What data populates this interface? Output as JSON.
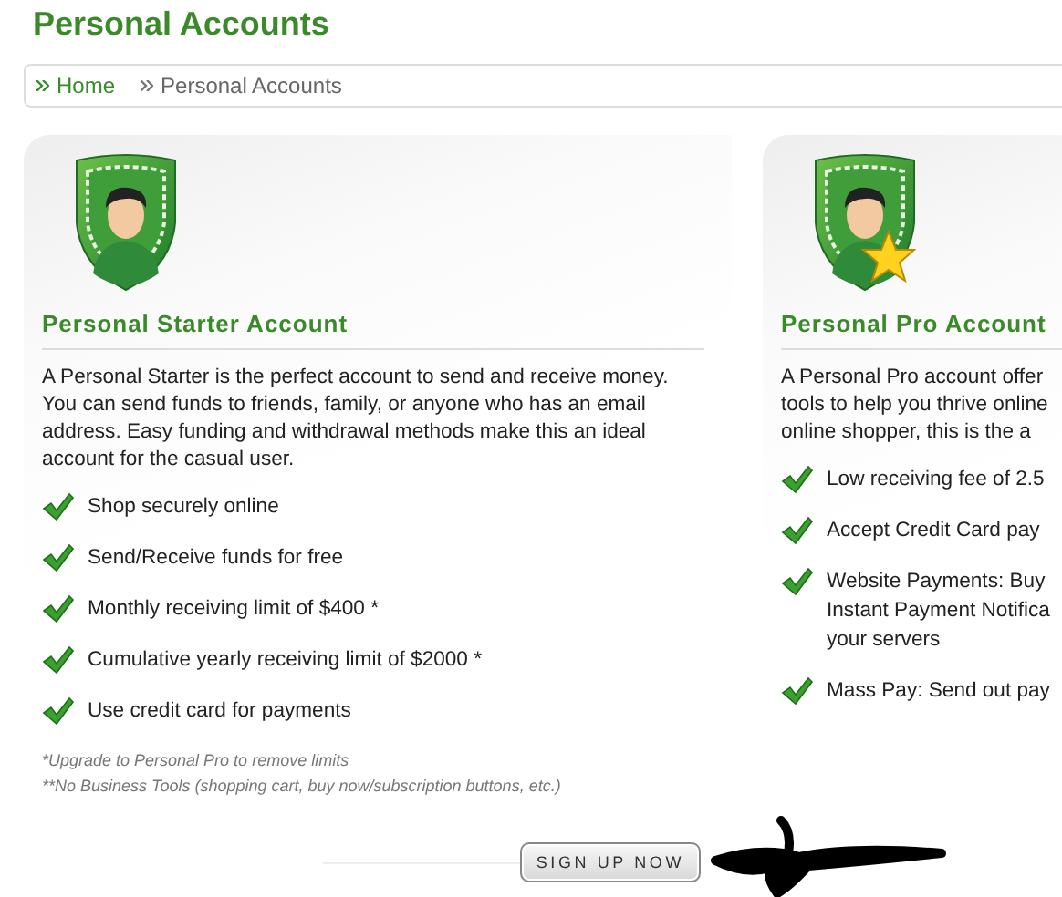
{
  "page_title": "Personal Accounts",
  "breadcrumb": [
    {
      "label": "Home",
      "link": true
    },
    {
      "label": "Personal Accounts",
      "link": false
    }
  ],
  "cards": [
    {
      "title": "Personal Starter Account",
      "star": false,
      "description_lines": [
        "A Personal Starter is the perfect account to send and receive money. You can send funds to friends, family, or anyone who has an email address. Easy funding and withdrawal methods make this an ideal account for the casual user."
      ],
      "features": [
        {
          "lines": [
            "Shop securely online"
          ]
        },
        {
          "lines": [
            "Send/Receive funds for free"
          ]
        },
        {
          "lines": [
            "Monthly receiving limit of $400 *"
          ]
        },
        {
          "lines": [
            "Cumulative yearly receiving limit of $2000 *"
          ]
        },
        {
          "lines": [
            "Use credit card for payments"
          ]
        }
      ],
      "footnotes": [
        "*Upgrade to Personal Pro to remove limits",
        "**No Business Tools (shopping cart, buy now/subscription buttons, etc.)"
      ],
      "button": "SIGN UP NOW"
    },
    {
      "title": "Personal Pro Account",
      "star": true,
      "description_lines": [
        "A Personal Pro account offer",
        "tools to help you thrive online",
        "online shopper, this is the a"
      ],
      "features": [
        {
          "lines": [
            "Low receiving fee of 2.5"
          ]
        },
        {
          "lines": [
            "Accept Credit Card pay"
          ]
        },
        {
          "lines": [
            "Website Payments: Buy",
            "Instant Payment Notifica",
            "your servers"
          ]
        },
        {
          "lines": [
            "Mass Pay: Send out pay"
          ]
        }
      ]
    }
  ]
}
